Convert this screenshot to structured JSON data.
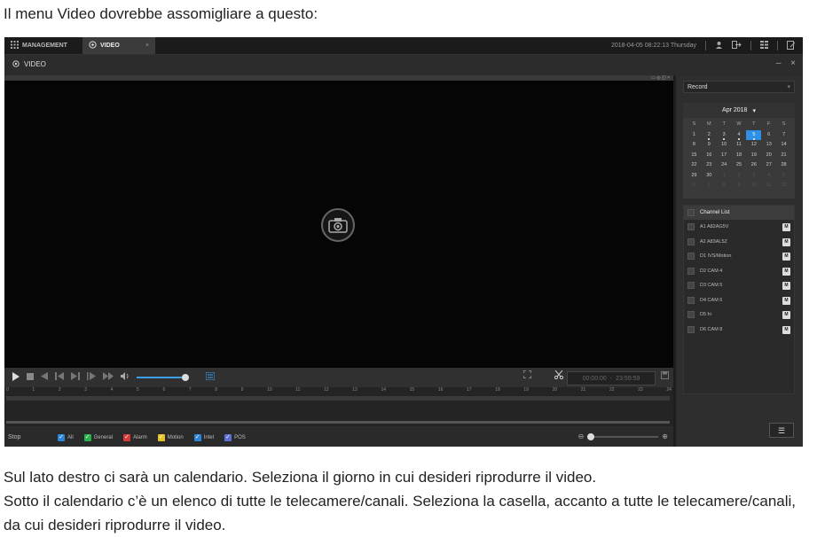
{
  "intro": "Il menu Video dovrebbe assomigliare a questo:",
  "outro": [
    "Sul lato destro ci sarà un calendario. Seleziona il giorno in cui desideri riprodurre il video.",
    "Sotto il calendario c’è un elenco di tutte le telecamere/canali. Seleziona la casella, accanto a tutte le telecamere/canali, da cui desideri riprodurre il video."
  ],
  "app": {
    "tabs": {
      "management": "MANAGEMENT",
      "video": "VIDEO",
      "close": "×"
    },
    "datetime": "2018-04-05 08:22:13 Thursday",
    "window_title": "VIDEO",
    "window_controls": "– ×",
    "controls": {
      "time_start": "00:00:00",
      "time_sep": "-",
      "time_end": "23:59:59"
    },
    "timeline_ticks": [
      "0",
      "1",
      "2",
      "3",
      "4",
      "5",
      "6",
      "7",
      "8",
      "9",
      "10",
      "11",
      "12",
      "13",
      "14",
      "15",
      "16",
      "17",
      "18",
      "19",
      "20",
      "21",
      "22",
      "23",
      "24"
    ],
    "filter": {
      "stop_label": "Stop",
      "items": [
        {
          "label": "All",
          "color": "#2b86d6"
        },
        {
          "label": "General",
          "color": "#27b24a"
        },
        {
          "label": "Alarm",
          "color": "#d83a3a"
        },
        {
          "label": "Motion",
          "color": "#e6c22a"
        },
        {
          "label": "Intel",
          "color": "#2b86d6"
        },
        {
          "label": "POS",
          "color": "#5b6fd6"
        }
      ]
    },
    "sidebar": {
      "record_type": "Record",
      "calendar": {
        "month": "Apr 2018",
        "weekdays": [
          "S",
          "M",
          "T",
          "W",
          "T",
          "F",
          "S"
        ],
        "days": [
          [
            "1",
            "2",
            "3",
            "4",
            "5",
            "6",
            "7"
          ],
          [
            "8",
            "9",
            "10",
            "11",
            "12",
            "13",
            "14"
          ],
          [
            "15",
            "16",
            "17",
            "18",
            "19",
            "20",
            "21"
          ],
          [
            "22",
            "23",
            "24",
            "25",
            "26",
            "27",
            "28"
          ],
          [
            "29",
            "30",
            "1",
            "2",
            "3",
            "4",
            "5"
          ],
          [
            "6",
            "7",
            "8",
            "9",
            "10",
            "11",
            "12"
          ]
        ],
        "selected_day": "5"
      },
      "channel_list_title": "Channel List",
      "channels": [
        "A1 A82AG5V",
        "A2 A83AL5Z",
        "D1 IVS/Motion",
        "D2 CAM 4",
        "D3 CAM 5",
        "D4 CAM 6",
        "D5 hi",
        "D6 CAM 8"
      ],
      "channel_badge": "M"
    }
  },
  "colors": {
    "accent": "#2e8fe6"
  }
}
